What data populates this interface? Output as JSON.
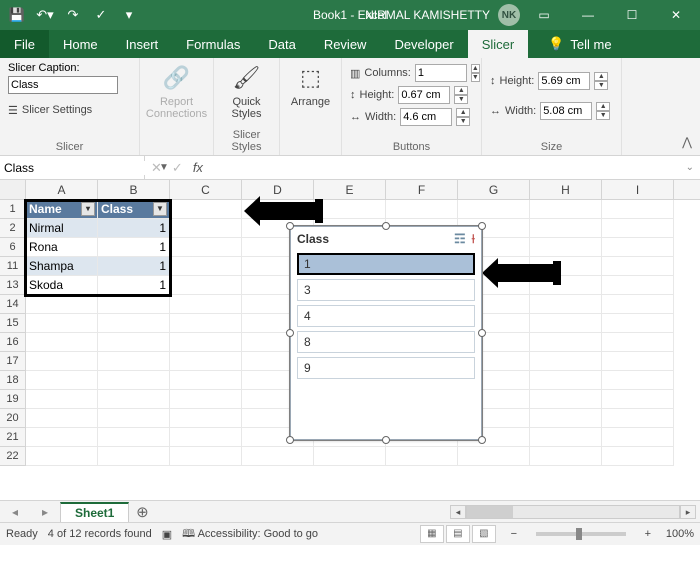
{
  "titlebar": {
    "title": "Book1 - Excel",
    "user": "NIRMAL KAMISHETTY",
    "user_initials": "NK"
  },
  "tabs": {
    "file": "File",
    "home": "Home",
    "insert": "Insert",
    "formulas": "Formulas",
    "data": "Data",
    "review": "Review",
    "developer": "Developer",
    "slicer": "Slicer",
    "tellme": "Tell me"
  },
  "ribbon": {
    "slicer_group": {
      "label": "Slicer",
      "caption_label": "Slicer Caption:",
      "caption_value": "Class",
      "settings": "Slicer Settings"
    },
    "report": {
      "label": "Report\nConnections"
    },
    "styles": {
      "label": "Quick\nStyles",
      "group": "Slicer Styles"
    },
    "arrange": {
      "label": "Arrange"
    },
    "buttons": {
      "group": "Buttons",
      "columns_label": "Columns:",
      "columns": "1",
      "height_label": "Height:",
      "height": "0.67 cm",
      "width_label": "Width:",
      "width": "4.6 cm"
    },
    "size": {
      "group": "Size",
      "height_label": "Height:",
      "height": "5.69 cm",
      "width_label": "Width:",
      "width": "5.08 cm"
    }
  },
  "namebox": "Class",
  "grid": {
    "cols": [
      "A",
      "B",
      "C",
      "D",
      "E",
      "F",
      "G",
      "H",
      "I"
    ],
    "row_numbers": [
      "1",
      "2",
      "6",
      "11",
      "13",
      "14",
      "15",
      "16",
      "17",
      "18",
      "19",
      "20",
      "21",
      "22"
    ],
    "table": {
      "headers": [
        "Name",
        "Class"
      ],
      "rows": [
        {
          "n": "2",
          "name": "Nirmal",
          "class": "1"
        },
        {
          "n": "6",
          "name": "Rona",
          "class": "1"
        },
        {
          "n": "11",
          "name": "Shampa",
          "class": "1"
        },
        {
          "n": "13",
          "name": "Skoda",
          "class": "1"
        }
      ]
    }
  },
  "slicer": {
    "title": "Class",
    "items": [
      "1",
      "3",
      "4",
      "8",
      "9"
    ],
    "active": 0
  },
  "sheet": {
    "name": "Sheet1"
  },
  "status": {
    "ready": "Ready",
    "records": "4 of 12 records found",
    "access": "Accessibility: Good to go",
    "zoom": "100%"
  }
}
